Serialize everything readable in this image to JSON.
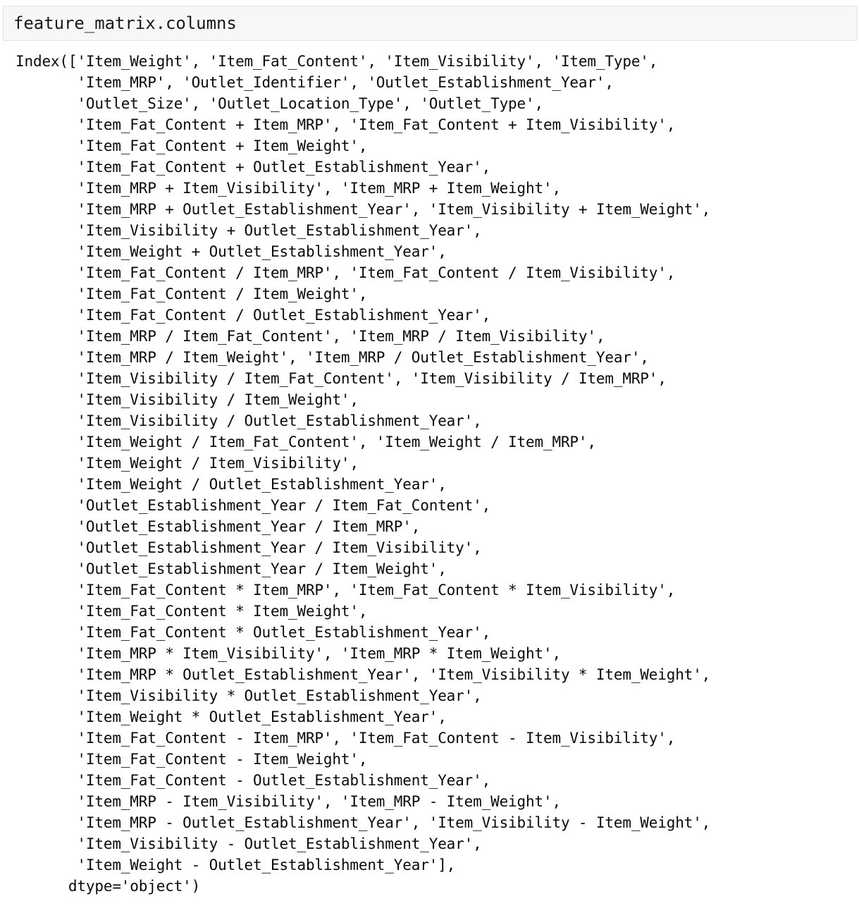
{
  "cell": {
    "source": "feature_matrix.columns",
    "background": "#f7f7f7",
    "border_color": "#e2e2e2"
  },
  "output": {
    "type": "pandas-index-repr",
    "prefix": "Index([",
    "suffix": "dtype='object')",
    "dtype": "object",
    "text": "Index(['Item_Weight', 'Item_Fat_Content', 'Item_Visibility', 'Item_Type',\n       'Item_MRP', 'Outlet_Identifier', 'Outlet_Establishment_Year',\n       'Outlet_Size', 'Outlet_Location_Type', 'Outlet_Type',\n       'Item_Fat_Content + Item_MRP', 'Item_Fat_Content + Item_Visibility',\n       'Item_Fat_Content + Item_Weight',\n       'Item_Fat_Content + Outlet_Establishment_Year',\n       'Item_MRP + Item_Visibility', 'Item_MRP + Item_Weight',\n       'Item_MRP + Outlet_Establishment_Year', 'Item_Visibility + Item_Weight',\n       'Item_Visibility + Outlet_Establishment_Year',\n       'Item_Weight + Outlet_Establishment_Year',\n       'Item_Fat_Content / Item_MRP', 'Item_Fat_Content / Item_Visibility',\n       'Item_Fat_Content / Item_Weight',\n       'Item_Fat_Content / Outlet_Establishment_Year',\n       'Item_MRP / Item_Fat_Content', 'Item_MRP / Item_Visibility',\n       'Item_MRP / Item_Weight', 'Item_MRP / Outlet_Establishment_Year',\n       'Item_Visibility / Item_Fat_Content', 'Item_Visibility / Item_MRP',\n       'Item_Visibility / Item_Weight',\n       'Item_Visibility / Outlet_Establishment_Year',\n       'Item_Weight / Item_Fat_Content', 'Item_Weight / Item_MRP',\n       'Item_Weight / Item_Visibility',\n       'Item_Weight / Outlet_Establishment_Year',\n       'Outlet_Establishment_Year / Item_Fat_Content',\n       'Outlet_Establishment_Year / Item_MRP',\n       'Outlet_Establishment_Year / Item_Visibility',\n       'Outlet_Establishment_Year / Item_Weight',\n       'Item_Fat_Content * Item_MRP', 'Item_Fat_Content * Item_Visibility',\n       'Item_Fat_Content * Item_Weight',\n       'Item_Fat_Content * Outlet_Establishment_Year',\n       'Item_MRP * Item_Visibility', 'Item_MRP * Item_Weight',\n       'Item_MRP * Outlet_Establishment_Year', 'Item_Visibility * Item_Weight',\n       'Item_Visibility * Outlet_Establishment_Year',\n       'Item_Weight * Outlet_Establishment_Year',\n       'Item_Fat_Content - Item_MRP', 'Item_Fat_Content - Item_Visibility',\n       'Item_Fat_Content - Item_Weight',\n       'Item_Fat_Content - Outlet_Establishment_Year',\n       'Item_MRP - Item_Visibility', 'Item_MRP - Item_Weight',\n       'Item_MRP - Outlet_Establishment_Year', 'Item_Visibility - Item_Weight',\n       'Item_Visibility - Outlet_Establishment_Year',\n       'Item_Weight - Outlet_Establishment_Year'],\n      dtype='object')",
    "columns": [
      "Item_Weight",
      "Item_Fat_Content",
      "Item_Visibility",
      "Item_Type",
      "Item_MRP",
      "Outlet_Identifier",
      "Outlet_Establishment_Year",
      "Outlet_Size",
      "Outlet_Location_Type",
      "Outlet_Type",
      "Item_Fat_Content + Item_MRP",
      "Item_Fat_Content + Item_Visibility",
      "Item_Fat_Content + Item_Weight",
      "Item_Fat_Content + Outlet_Establishment_Year",
      "Item_MRP + Item_Visibility",
      "Item_MRP + Item_Weight",
      "Item_MRP + Outlet_Establishment_Year",
      "Item_Visibility + Item_Weight",
      "Item_Visibility + Outlet_Establishment_Year",
      "Item_Weight + Outlet_Establishment_Year",
      "Item_Fat_Content / Item_MRP",
      "Item_Fat_Content / Item_Visibility",
      "Item_Fat_Content / Item_Weight",
      "Item_Fat_Content / Outlet_Establishment_Year",
      "Item_MRP / Item_Fat_Content",
      "Item_MRP / Item_Visibility",
      "Item_MRP / Item_Weight",
      "Item_MRP / Outlet_Establishment_Year",
      "Item_Visibility / Item_Fat_Content",
      "Item_Visibility / Item_MRP",
      "Item_Visibility / Item_Weight",
      "Item_Visibility / Outlet_Establishment_Year",
      "Item_Weight / Item_Fat_Content",
      "Item_Weight / Item_MRP",
      "Item_Weight / Item_Visibility",
      "Item_Weight / Outlet_Establishment_Year",
      "Outlet_Establishment_Year / Item_Fat_Content",
      "Outlet_Establishment_Year / Item_MRP",
      "Outlet_Establishment_Year / Item_Visibility",
      "Outlet_Establishment_Year / Item_Weight",
      "Item_Fat_Content * Item_MRP",
      "Item_Fat_Content * Item_Visibility",
      "Item_Fat_Content * Item_Weight",
      "Item_Fat_Content * Outlet_Establishment_Year",
      "Item_MRP * Item_Visibility",
      "Item_MRP * Item_Weight",
      "Item_MRP * Outlet_Establishment_Year",
      "Item_Visibility * Item_Weight",
      "Item_Visibility * Outlet_Establishment_Year",
      "Item_Weight * Outlet_Establishment_Year",
      "Item_Fat_Content - Item_MRP",
      "Item_Fat_Content - Item_Visibility",
      "Item_Fat_Content - Item_Weight",
      "Item_Fat_Content - Outlet_Establishment_Year",
      "Item_MRP - Item_Visibility",
      "Item_MRP - Item_Weight",
      "Item_MRP - Outlet_Establishment_Year",
      "Item_Visibility - Item_Weight",
      "Item_Visibility - Outlet_Establishment_Year",
      "Item_Weight - Outlet_Establishment_Year"
    ]
  }
}
